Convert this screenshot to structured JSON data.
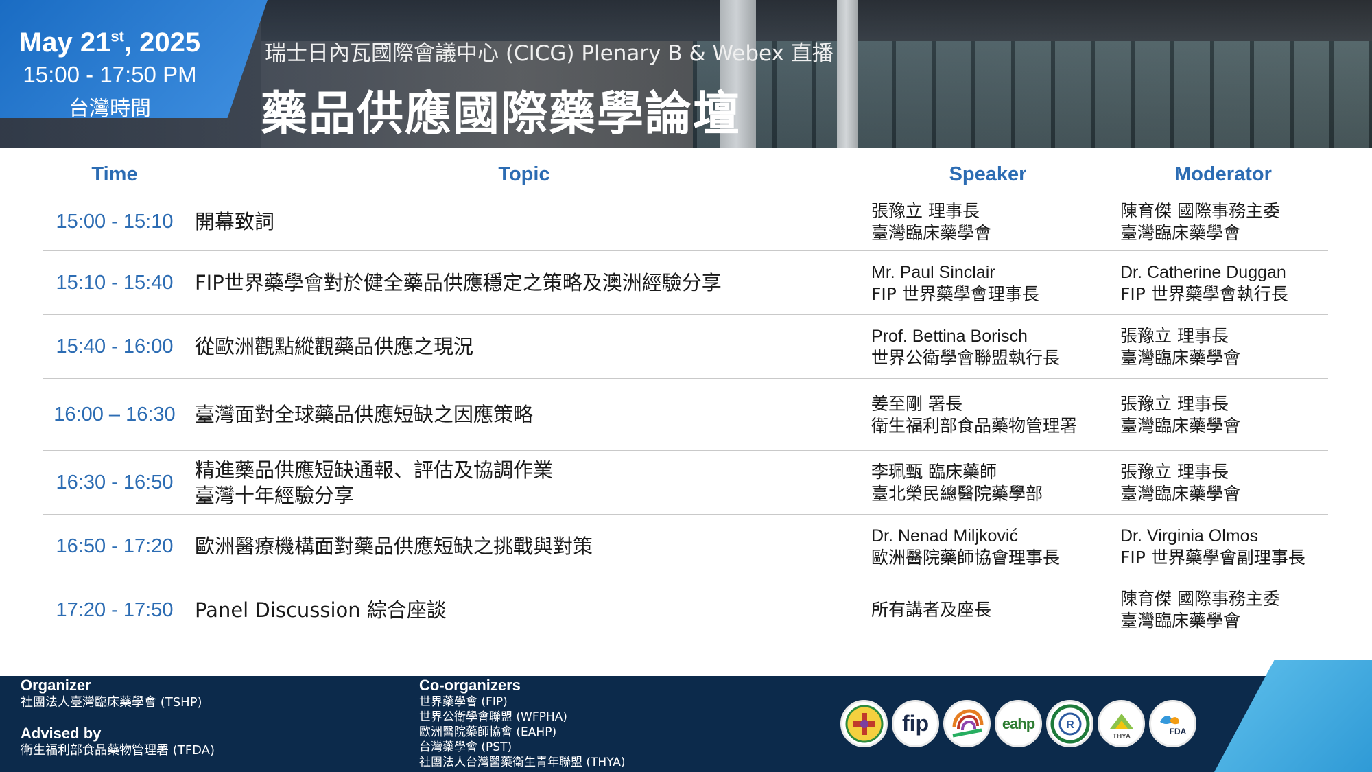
{
  "header": {
    "date_main": "May 21",
    "date_sup": "st",
    "date_year": ", 2025",
    "time_range": "15:00 - 17:50 PM",
    "timezone": "台灣時間",
    "subtitle": "瑞士日內瓦國際會議中心 (CICG) Plenary B  & Webex 直播",
    "title": "藥品供應國際藥學論壇"
  },
  "columns": {
    "time": "Time",
    "topic": "Topic",
    "speaker": "Speaker",
    "moderator": "Moderator"
  },
  "agenda": [
    {
      "time": "15:00 - 15:10",
      "topic": [
        "開幕致詞"
      ],
      "speaker": [
        "張豫立 理事長",
        "臺灣臨床藥學會"
      ],
      "moderator": [
        "陳育傑 國際事務主委",
        "臺灣臨床藥學會"
      ]
    },
    {
      "time": "15:10 - 15:40",
      "topic": [
        "FIP世界藥學會對於健全藥品供應穩定之策略及澳洲經驗分享"
      ],
      "speaker": [
        "Mr. Paul Sinclair",
        "FIP 世界藥學會理事長"
      ],
      "moderator": [
        "Dr. Catherine Duggan",
        "FIP 世界藥學會執行長"
      ]
    },
    {
      "time": "15:40 - 16:00",
      "topic": [
        "從歐洲觀點縱觀藥品供應之現況"
      ],
      "speaker": [
        "Prof. Bettina Borisch",
        "世界公衛學會聯盟執行長"
      ],
      "moderator": [
        "張豫立 理事長",
        "臺灣臨床藥學會"
      ]
    },
    {
      "time": "16:00 – 16:30",
      "topic": [
        "臺灣面對全球藥品供應短缺之因應策略"
      ],
      "speaker": [
        "姜至剛 署長",
        "衛生福利部食品藥物管理署"
      ],
      "moderator": [
        "張豫立 理事長",
        "臺灣臨床藥學會"
      ]
    },
    {
      "time": "16:30 - 16:50",
      "topic": [
        "精進藥品供應短缺通報、評估及協調作業",
        "臺灣十年經驗分享"
      ],
      "speaker": [
        "李珮甄 臨床藥師",
        "臺北榮民總醫院藥學部"
      ],
      "moderator": [
        "張豫立 理事長",
        "臺灣臨床藥學會"
      ]
    },
    {
      "time": "16:50 - 17:20",
      "topic": [
        "歐洲醫療機構面對藥品供應短缺之挑戰與對策"
      ],
      "speaker": [
        "Dr. Nenad Miljković",
        "歐洲醫院藥師協會理事長"
      ],
      "moderator": [
        "Dr. Virginia Olmos",
        "FIP 世界藥學會副理事長"
      ]
    },
    {
      "time": "17:20 - 17:50",
      "topic": [
        "Panel Discussion 綜合座談"
      ],
      "speaker": [
        "所有講者及座長"
      ],
      "moderator": [
        "陳育傑 國際事務主委",
        "臺灣臨床藥學會"
      ]
    }
  ],
  "footer": {
    "organizer_heading": "Organizer",
    "organizer": "社團法人臺灣臨床藥學會 (TSHP)",
    "advised_heading": "Advised by",
    "advised": "衛生福利部食品藥物管理署 (TFDA)",
    "coorganizers_heading": "Co-organizers",
    "coorganizers": [
      "世界藥學會 (FIP)",
      "世界公衛學會聯盟 (WFPHA)",
      "歐洲醫院藥師協會 (EAHP)",
      "台灣藥學會 (PST)",
      "社團法人台灣醫藥衛生青年聯盟 (THYA)"
    ],
    "logos": [
      {
        "icon": "tshp-logo-icon",
        "text": ""
      },
      {
        "icon": "fip-logo-icon",
        "text": "fip"
      },
      {
        "icon": "wfpha-logo-icon",
        "text": ""
      },
      {
        "icon": "eahp-logo-icon",
        "text": "eahp"
      },
      {
        "icon": "pst-logo-icon",
        "text": "R"
      },
      {
        "icon": "thya-logo-icon",
        "text": "THYA"
      },
      {
        "icon": "fda-logo-icon",
        "text": "FDA"
      }
    ]
  },
  "colors": {
    "accent_blue": "#2c6cb3",
    "date_box": "#1a6cc3",
    "footer_navy": "#0c2a4b",
    "footer_accent": "#3fa8e0"
  }
}
